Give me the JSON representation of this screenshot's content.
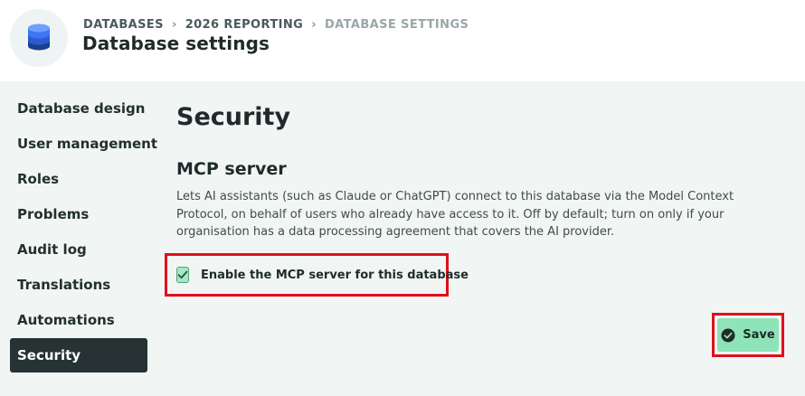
{
  "header": {
    "breadcrumb": [
      {
        "label": "DATABASES"
      },
      {
        "label": "2026 REPORTING"
      },
      {
        "label": "DATABASE SETTINGS"
      }
    ],
    "title": "Database settings",
    "avatar_icon": "database-icon"
  },
  "sidebar": {
    "items": [
      {
        "label": "Database design",
        "active": false
      },
      {
        "label": "User management",
        "active": false
      },
      {
        "label": "Roles",
        "active": false
      },
      {
        "label": "Problems",
        "active": false
      },
      {
        "label": "Audit log",
        "active": false
      },
      {
        "label": "Translations",
        "active": false
      },
      {
        "label": "Automations",
        "active": false
      },
      {
        "label": "Security",
        "active": true
      }
    ]
  },
  "main": {
    "section_title": "Security",
    "mcp": {
      "title": "MCP server",
      "description": "Lets AI assistants (such as Claude or ChatGPT) connect to this database via the Model Context Protocol, on behalf of users who already have access to it. Off by default; turn on only if your organisation has a data processing agreement that covers the AI provider.",
      "checkbox_label": "Enable the MCP server for this database",
      "checked": true
    },
    "save_label": "Save"
  },
  "colors": {
    "sidebar_active_bg": "#263233",
    "save_button_bg": "#8fe3b8",
    "checkbox_bg": "#a5e7c6",
    "highlight_border": "#e0101a",
    "content_bg": "#f1f5f4"
  }
}
